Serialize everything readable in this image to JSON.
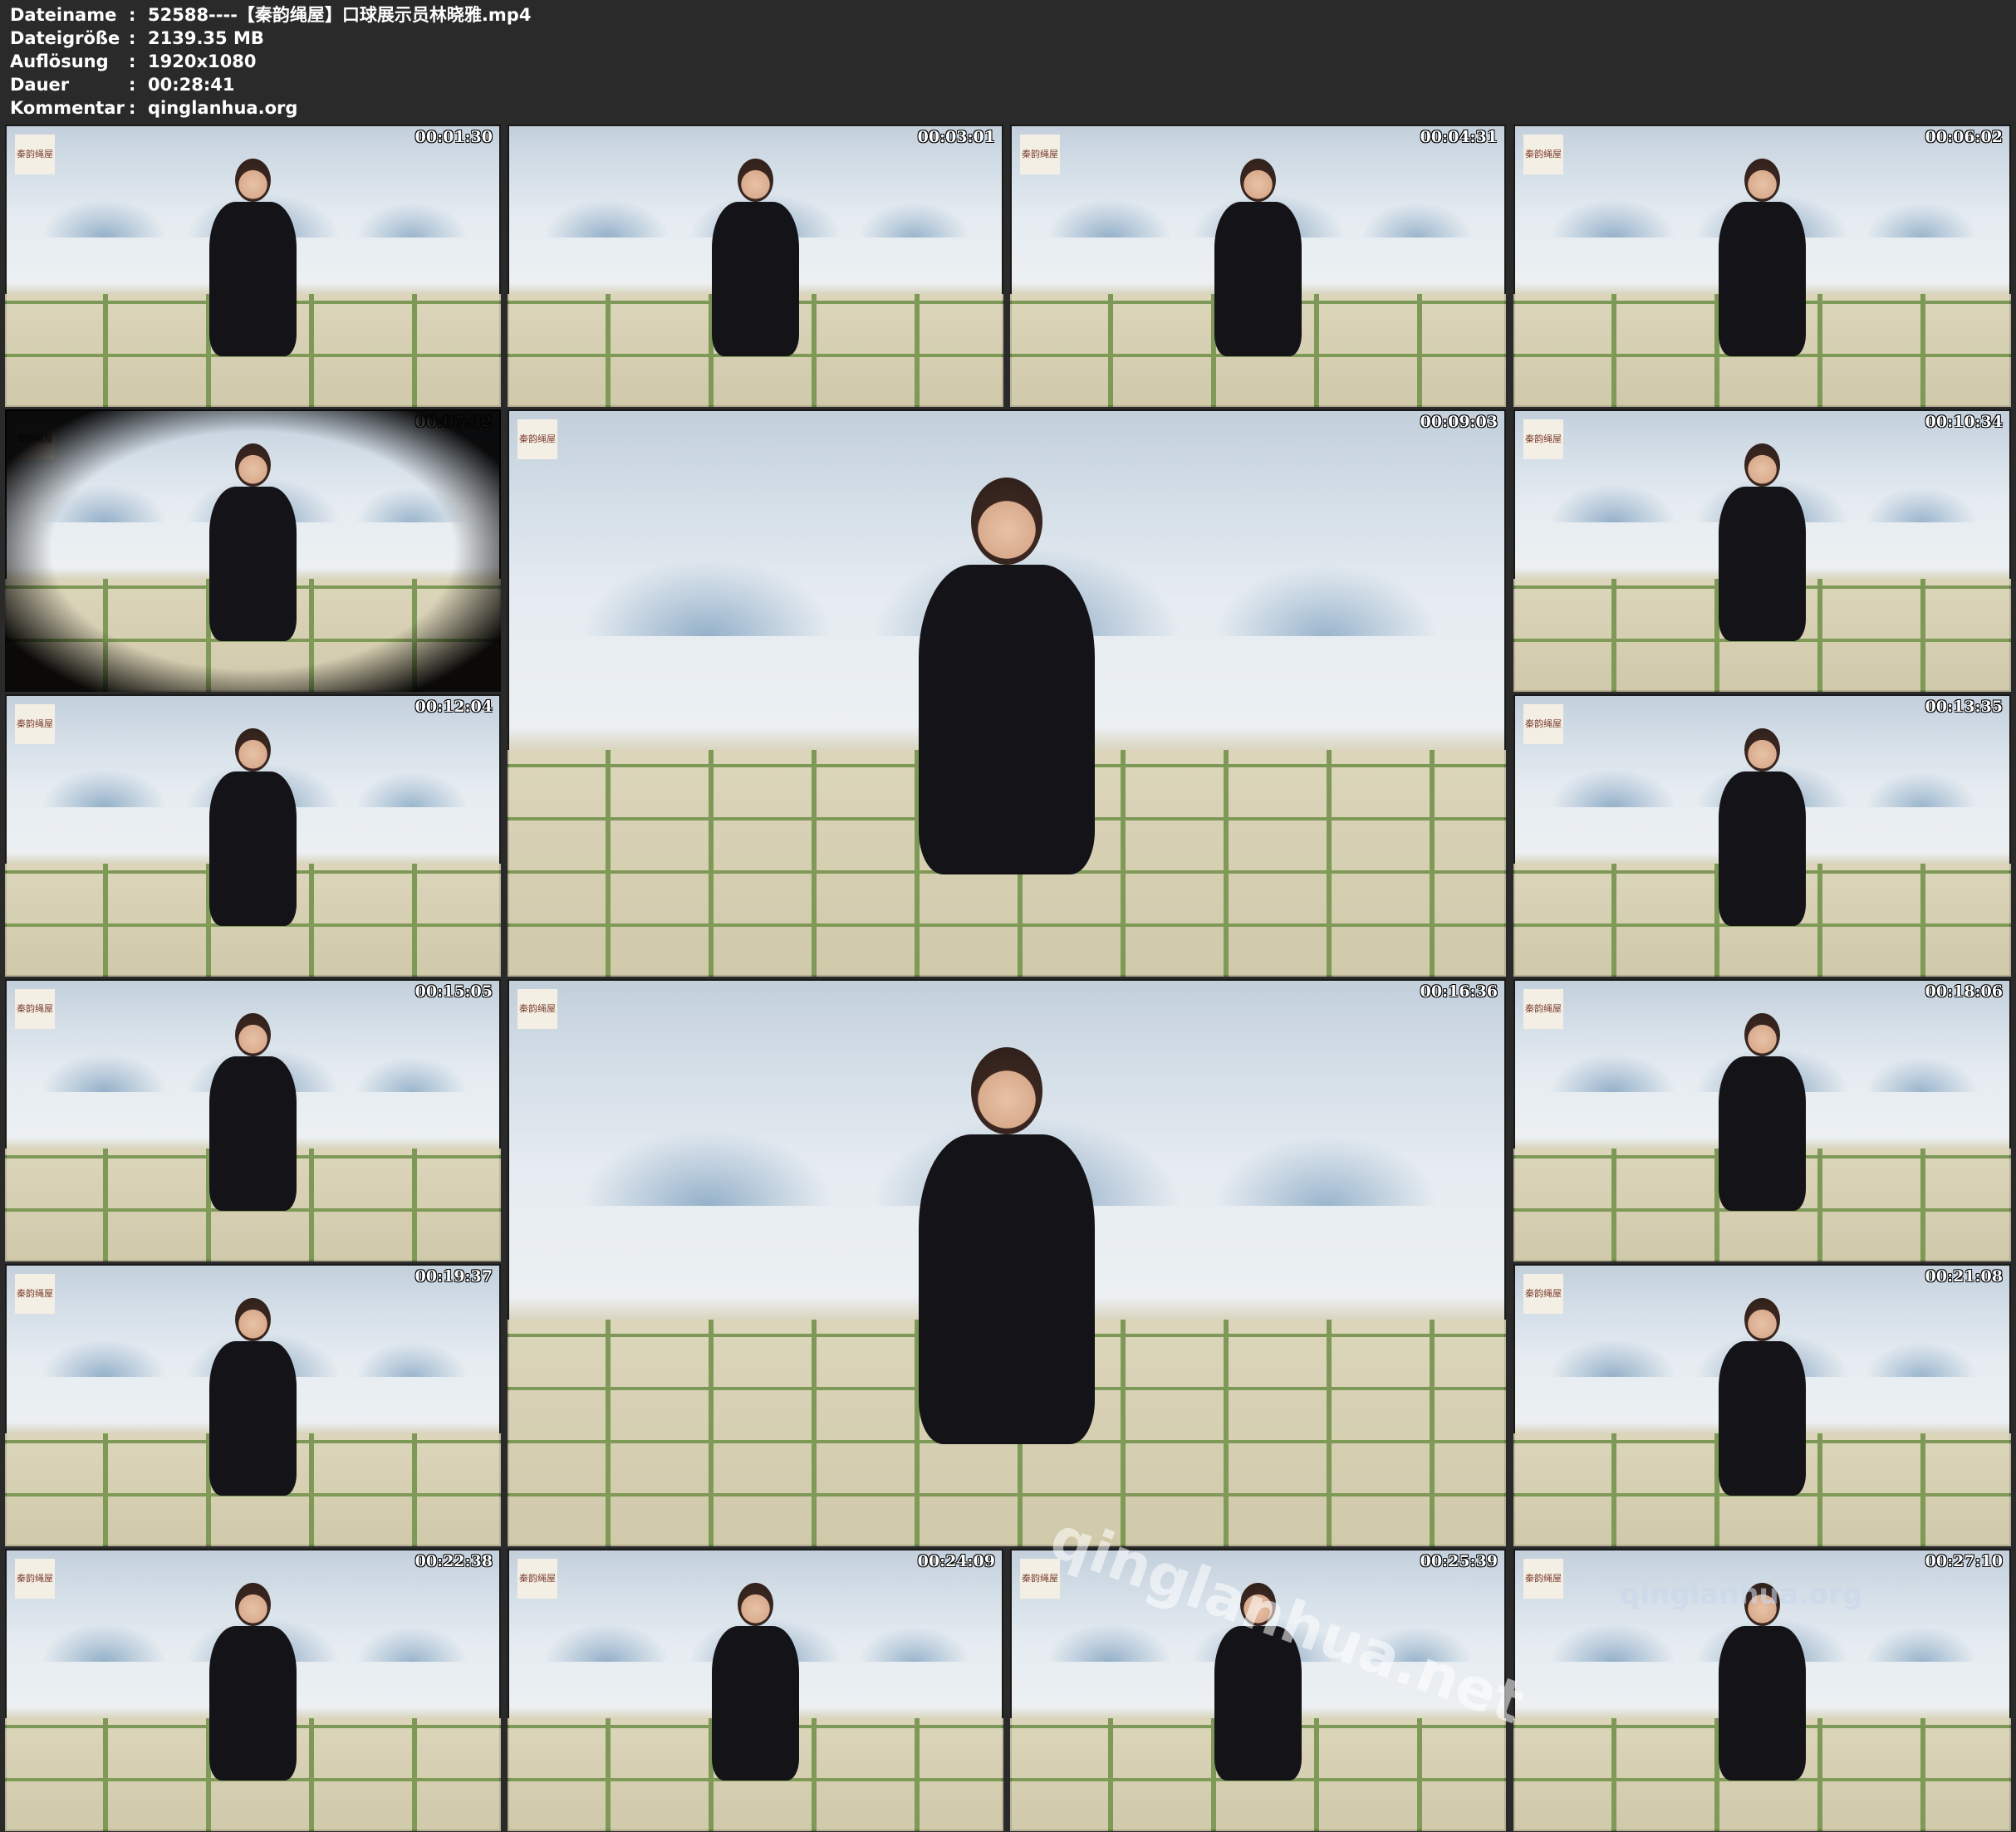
{
  "info": [
    {
      "label": "Dateiname",
      "value": "52588----【秦韵绳屋】口球展示员林晓雅.mp4"
    },
    {
      "label": "Dateigröße",
      "value": "2139.35 MB"
    },
    {
      "label": "Auflösung",
      "value": "1920x1080"
    },
    {
      "label": "Dauer",
      "value": "00:28:41"
    },
    {
      "label": "Kommentar",
      "value": "qinglanhua.org"
    }
  ],
  "separator": ":",
  "thumbnails": [
    {
      "time": "00:01:30"
    },
    {
      "time": "00:03:01"
    },
    {
      "time": "00:04:31"
    },
    {
      "time": "00:06:02"
    },
    {
      "time": "00:07:32"
    },
    {
      "time": "00:09:03"
    },
    {
      "time": "00:10:34"
    },
    {
      "time": "00:12:04"
    },
    {
      "time": "00:13:35"
    },
    {
      "time": "00:15:05"
    },
    {
      "time": "00:16:36"
    },
    {
      "time": "00:18:06"
    },
    {
      "time": "00:19:37"
    },
    {
      "time": "00:21:08"
    },
    {
      "time": "00:22:38"
    },
    {
      "time": "00:24:09"
    },
    {
      "time": "00:25:39"
    },
    {
      "time": "00:27:10"
    }
  ],
  "logo_text": "秦韵绳屋",
  "watermarks": [
    "qinglanhua.net",
    "qinglanhua.org"
  ]
}
